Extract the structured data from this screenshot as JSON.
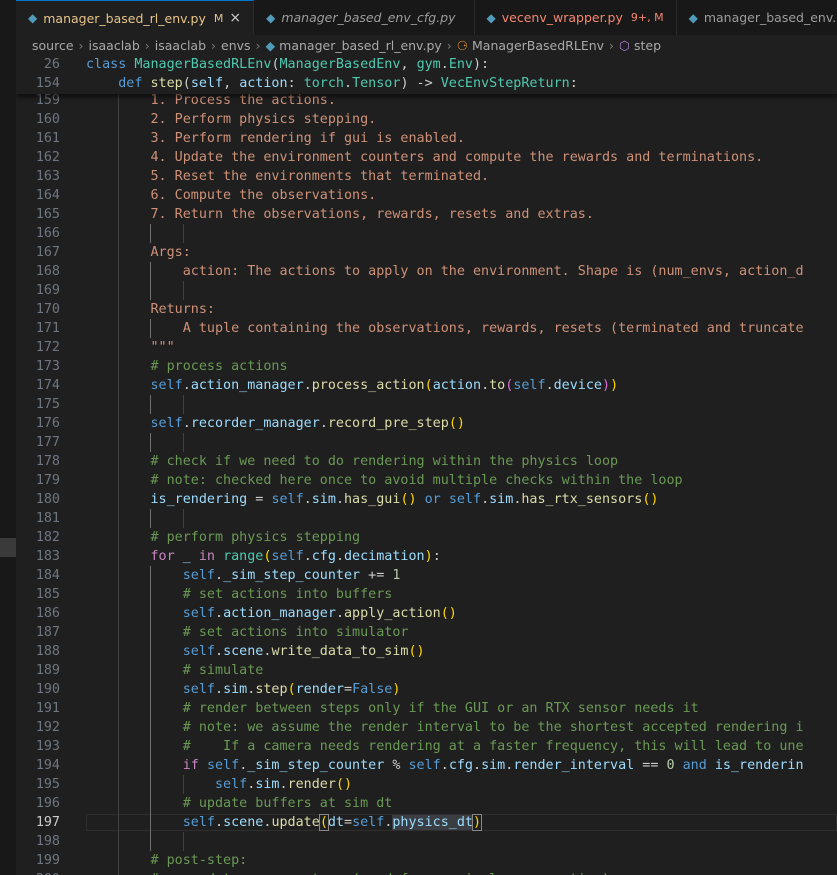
{
  "tabs": [
    {
      "name": "manager_based_rl_env.py",
      "mod": "M",
      "active": true,
      "italic": false,
      "error": false,
      "close": "×"
    },
    {
      "name": "manager_based_env_cfg.py",
      "mod": "",
      "active": false,
      "italic": true,
      "error": false,
      "close": ""
    },
    {
      "name": "vecenv_wrapper.py",
      "mod": "9+, M",
      "active": false,
      "italic": false,
      "error": true,
      "close": ""
    },
    {
      "name": "manager_based_env.p",
      "mod": "",
      "active": false,
      "italic": false,
      "error": false,
      "close": ""
    }
  ],
  "breadcrumb": [
    "source",
    "isaaclab",
    "isaaclab",
    "envs",
    "manager_based_rl_env.py",
    "ManagerBasedRLEnv",
    "step"
  ],
  "current_line": 197,
  "sticky": [
    {
      "num": "26",
      "indent": 0,
      "tokens": [
        [
          "kw",
          "class "
        ],
        [
          "cl",
          "ManagerBasedRLEnv"
        ],
        [
          "pn",
          "("
        ],
        [
          "cl",
          "ManagerBasedEnv"
        ],
        [
          "pn",
          ", "
        ],
        [
          "cl",
          "gym"
        ],
        [
          "pn",
          "."
        ],
        [
          "cl",
          "Env"
        ],
        [
          "pn",
          "):"
        ]
      ]
    },
    {
      "num": "154",
      "indent": 4,
      "tokens": [
        [
          "kw",
          "def "
        ],
        [
          "fn",
          "step"
        ],
        [
          "pn",
          "("
        ],
        [
          "pm",
          "self"
        ],
        [
          "pn",
          ", "
        ],
        [
          "pm",
          "action"
        ],
        [
          "pn",
          ": "
        ],
        [
          "cl",
          "torch"
        ],
        [
          "pn",
          "."
        ],
        [
          "cl",
          "Tensor"
        ],
        [
          "pn",
          ") -> "
        ],
        [
          "cl",
          "VecEnvStepReturn"
        ],
        [
          "pn",
          ":"
        ]
      ]
    }
  ],
  "lines": [
    {
      "num": "159",
      "indent": 8,
      "tokens": [
        [
          "st",
          "1. Process the actions."
        ]
      ]
    },
    {
      "num": "160",
      "indent": 8,
      "tokens": [
        [
          "st",
          "2. Perform physics stepping."
        ]
      ]
    },
    {
      "num": "161",
      "indent": 8,
      "tokens": [
        [
          "st",
          "3. Perform rendering if gui is enabled."
        ]
      ]
    },
    {
      "num": "162",
      "indent": 8,
      "tokens": [
        [
          "st",
          "4. Update the environment counters and compute the rewards and terminations."
        ]
      ]
    },
    {
      "num": "163",
      "indent": 8,
      "tokens": [
        [
          "st",
          "5. Reset the environments that terminated."
        ]
      ]
    },
    {
      "num": "164",
      "indent": 8,
      "tokens": [
        [
          "st",
          "6. Compute the observations."
        ]
      ]
    },
    {
      "num": "165",
      "indent": 8,
      "tokens": [
        [
          "st",
          "7. Return the observations, rewards, resets and extras."
        ]
      ]
    },
    {
      "num": "166",
      "indent": 0,
      "tokens": []
    },
    {
      "num": "167",
      "indent": 8,
      "tokens": [
        [
          "st",
          "Args:"
        ]
      ]
    },
    {
      "num": "168",
      "indent": 12,
      "tokens": [
        [
          "st",
          "action: The actions to apply on the environment. Shape is (num_envs, action_d"
        ]
      ]
    },
    {
      "num": "169",
      "indent": 0,
      "tokens": []
    },
    {
      "num": "170",
      "indent": 8,
      "tokens": [
        [
          "st",
          "Returns:"
        ]
      ]
    },
    {
      "num": "171",
      "indent": 12,
      "tokens": [
        [
          "st",
          "A tuple containing the observations, rewards, resets (terminated and truncate"
        ]
      ]
    },
    {
      "num": "172",
      "indent": 8,
      "tokens": [
        [
          "st",
          "\"\"\""
        ]
      ]
    },
    {
      "num": "173",
      "indent": 8,
      "tokens": [
        [
          "cm",
          "# process actions"
        ]
      ]
    },
    {
      "num": "174",
      "indent": 8,
      "tokens": [
        [
          "kw",
          "self"
        ],
        [
          "pn",
          "."
        ],
        [
          "vr",
          "action_manager"
        ],
        [
          "pn",
          "."
        ],
        [
          "fn",
          "process_action"
        ],
        [
          "br1",
          "("
        ],
        [
          "vr",
          "action"
        ],
        [
          "pn",
          "."
        ],
        [
          "fn",
          "to"
        ],
        [
          "br2",
          "("
        ],
        [
          "kw",
          "self"
        ],
        [
          "pn",
          "."
        ],
        [
          "vr",
          "device"
        ],
        [
          "br2",
          ")"
        ],
        [
          "br1",
          ")"
        ]
      ]
    },
    {
      "num": "175",
      "indent": 0,
      "tokens": []
    },
    {
      "num": "176",
      "indent": 8,
      "tokens": [
        [
          "kw",
          "self"
        ],
        [
          "pn",
          "."
        ],
        [
          "vr",
          "recorder_manager"
        ],
        [
          "pn",
          "."
        ],
        [
          "fn",
          "record_pre_step"
        ],
        [
          "br1",
          "()"
        ]
      ]
    },
    {
      "num": "177",
      "indent": 0,
      "tokens": []
    },
    {
      "num": "178",
      "indent": 8,
      "tokens": [
        [
          "cm",
          "# check if we need to do rendering within the physics loop"
        ]
      ]
    },
    {
      "num": "179",
      "indent": 8,
      "tokens": [
        [
          "cm",
          "# note: checked here once to avoid multiple checks within the loop"
        ]
      ]
    },
    {
      "num": "180",
      "indent": 8,
      "tokens": [
        [
          "vr",
          "is_rendering"
        ],
        [
          "pn",
          " = "
        ],
        [
          "kw",
          "self"
        ],
        [
          "pn",
          "."
        ],
        [
          "vr",
          "sim"
        ],
        [
          "pn",
          "."
        ],
        [
          "fn",
          "has_gui"
        ],
        [
          "br1",
          "()"
        ],
        [
          "pn",
          " "
        ],
        [
          "kw",
          "or"
        ],
        [
          "pn",
          " "
        ],
        [
          "kw",
          "self"
        ],
        [
          "pn",
          "."
        ],
        [
          "vr",
          "sim"
        ],
        [
          "pn",
          "."
        ],
        [
          "fn",
          "has_rtx_sensors"
        ],
        [
          "br1",
          "()"
        ]
      ]
    },
    {
      "num": "181",
      "indent": 0,
      "tokens": []
    },
    {
      "num": "182",
      "indent": 8,
      "tokens": [
        [
          "cm",
          "# perform physics stepping"
        ]
      ]
    },
    {
      "num": "183",
      "indent": 8,
      "tokens": [
        [
          "kc",
          "for"
        ],
        [
          "pn",
          " "
        ],
        [
          "vr",
          "_"
        ],
        [
          "pn",
          " "
        ],
        [
          "kc",
          "in"
        ],
        [
          "pn",
          " "
        ],
        [
          "cl",
          "range"
        ],
        [
          "br1",
          "("
        ],
        [
          "kw",
          "self"
        ],
        [
          "pn",
          "."
        ],
        [
          "vr",
          "cfg"
        ],
        [
          "pn",
          "."
        ],
        [
          "vr",
          "decimation"
        ],
        [
          "br1",
          ")"
        ],
        [
          "pn",
          ":"
        ]
      ]
    },
    {
      "num": "184",
      "indent": 12,
      "tokens": [
        [
          "kw",
          "self"
        ],
        [
          "pn",
          "."
        ],
        [
          "vr",
          "_sim_step_counter"
        ],
        [
          "pn",
          " += "
        ],
        [
          "nm",
          "1"
        ]
      ]
    },
    {
      "num": "185",
      "indent": 12,
      "tokens": [
        [
          "cm",
          "# set actions into buffers"
        ]
      ]
    },
    {
      "num": "186",
      "indent": 12,
      "tokens": [
        [
          "kw",
          "self"
        ],
        [
          "pn",
          "."
        ],
        [
          "vr",
          "action_manager"
        ],
        [
          "pn",
          "."
        ],
        [
          "fn",
          "apply_action"
        ],
        [
          "br1",
          "()"
        ]
      ]
    },
    {
      "num": "187",
      "indent": 12,
      "tokens": [
        [
          "cm",
          "# set actions into simulator"
        ]
      ]
    },
    {
      "num": "188",
      "indent": 12,
      "tokens": [
        [
          "kw",
          "self"
        ],
        [
          "pn",
          "."
        ],
        [
          "vr",
          "scene"
        ],
        [
          "pn",
          "."
        ],
        [
          "fn",
          "write_data_to_sim"
        ],
        [
          "br1",
          "()"
        ]
      ]
    },
    {
      "num": "189",
      "indent": 12,
      "tokens": [
        [
          "cm",
          "# simulate"
        ]
      ]
    },
    {
      "num": "190",
      "indent": 12,
      "tokens": [
        [
          "kw",
          "self"
        ],
        [
          "pn",
          "."
        ],
        [
          "vr",
          "sim"
        ],
        [
          "pn",
          "."
        ],
        [
          "fn",
          "step"
        ],
        [
          "br1",
          "("
        ],
        [
          "pm",
          "render"
        ],
        [
          "pn",
          "="
        ],
        [
          "kw",
          "False"
        ],
        [
          "br1",
          ")"
        ]
      ]
    },
    {
      "num": "191",
      "indent": 12,
      "tokens": [
        [
          "cm",
          "# render between steps only if the GUI or an RTX sensor needs it"
        ]
      ]
    },
    {
      "num": "192",
      "indent": 12,
      "tokens": [
        [
          "cm",
          "# note: we assume the render interval to be the shortest accepted rendering i"
        ]
      ]
    },
    {
      "num": "193",
      "indent": 12,
      "tokens": [
        [
          "cm",
          "#    If a camera needs rendering at a faster frequency, this will lead to une"
        ]
      ]
    },
    {
      "num": "194",
      "indent": 12,
      "tokens": [
        [
          "kc",
          "if"
        ],
        [
          "pn",
          " "
        ],
        [
          "kw",
          "self"
        ],
        [
          "pn",
          "."
        ],
        [
          "vr",
          "_sim_step_counter"
        ],
        [
          "pn",
          " % "
        ],
        [
          "kw",
          "self"
        ],
        [
          "pn",
          "."
        ],
        [
          "vr",
          "cfg"
        ],
        [
          "pn",
          "."
        ],
        [
          "vr",
          "sim"
        ],
        [
          "pn",
          "."
        ],
        [
          "vr",
          "render_interval"
        ],
        [
          "pn",
          " == "
        ],
        [
          "nm",
          "0"
        ],
        [
          "pn",
          " "
        ],
        [
          "kw",
          "and"
        ],
        [
          "pn",
          " "
        ],
        [
          "vr",
          "is_renderin"
        ]
      ]
    },
    {
      "num": "195",
      "indent": 16,
      "tokens": [
        [
          "kw",
          "self"
        ],
        [
          "pn",
          "."
        ],
        [
          "vr",
          "sim"
        ],
        [
          "pn",
          "."
        ],
        [
          "fn",
          "render"
        ],
        [
          "br1",
          "()"
        ]
      ]
    },
    {
      "num": "196",
      "indent": 12,
      "tokens": [
        [
          "cm",
          "# update buffers at sim dt"
        ]
      ]
    },
    {
      "num": "197",
      "indent": 12,
      "tokens": [
        [
          "kw",
          "self"
        ],
        [
          "pn",
          "."
        ],
        [
          "vr",
          "scene"
        ],
        [
          "pn",
          "."
        ],
        [
          "fn",
          "update"
        ],
        [
          "br1 bm",
          "("
        ],
        [
          "pm",
          "dt"
        ],
        [
          "pn",
          "="
        ],
        [
          "kw",
          "self"
        ],
        [
          "pn",
          "."
        ],
        [
          "vr hl",
          "physics_dt"
        ],
        [
          "br1",
          "",
          ""
        ],
        [
          "br1 bm",
          ")"
        ]
      ]
    },
    {
      "num": "198",
      "indent": 0,
      "tokens": []
    },
    {
      "num": "199",
      "indent": 8,
      "tokens": [
        [
          "cm",
          "# post-step:"
        ]
      ]
    },
    {
      "num": "200",
      "indent": 8,
      "tokens": [
        [
          "cm",
          "# -> update env counters (used for curriculum generation)"
        ]
      ]
    }
  ]
}
